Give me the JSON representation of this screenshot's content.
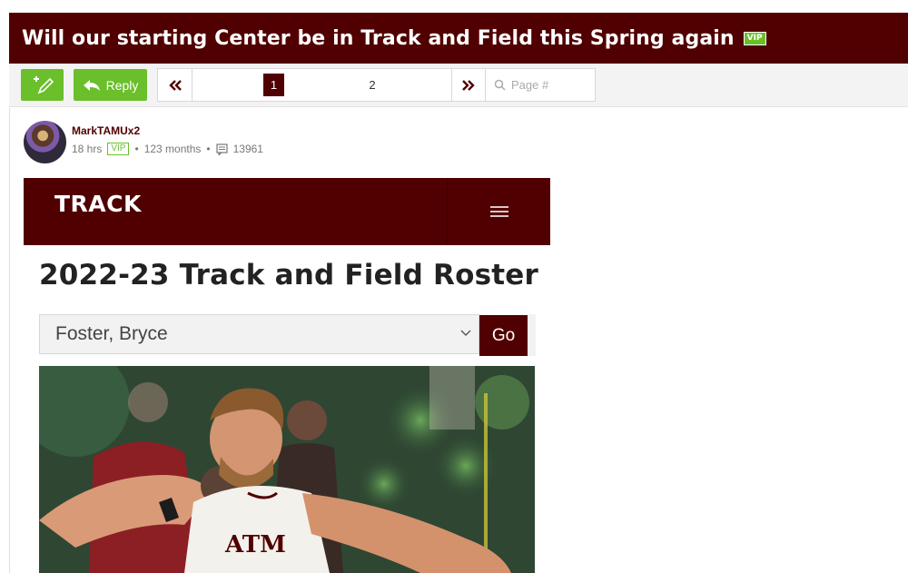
{
  "thread": {
    "title": "Will our starting Center be in Track and Field this Spring again",
    "badge": "VIP"
  },
  "toolbar": {
    "new_icon": "pencil-plus-icon",
    "reply_label": "Reply",
    "reply_icon": "reply-arrow-icon"
  },
  "pagination": {
    "first_icon": "double-chevron-left-icon",
    "current_page": "1",
    "page_2": "2",
    "last_icon": "double-chevron-right-icon",
    "jump_placeholder": "Page #"
  },
  "post": {
    "author": "MarkTAMUx2",
    "time_ago": "18 hrs",
    "badge": "VIP",
    "tenure": "123 months",
    "post_count": "13961"
  },
  "embed": {
    "site_name": "TRACK",
    "menu_icon": "hamburger-menu-icon",
    "heading": "2022-23 Track and Field Roster",
    "selected_athlete": "Foster, Bryce",
    "go_label": "Go",
    "photo_text": "ATM",
    "colors": {
      "brand": "#500000",
      "accent_green": "#6abf2b"
    }
  }
}
